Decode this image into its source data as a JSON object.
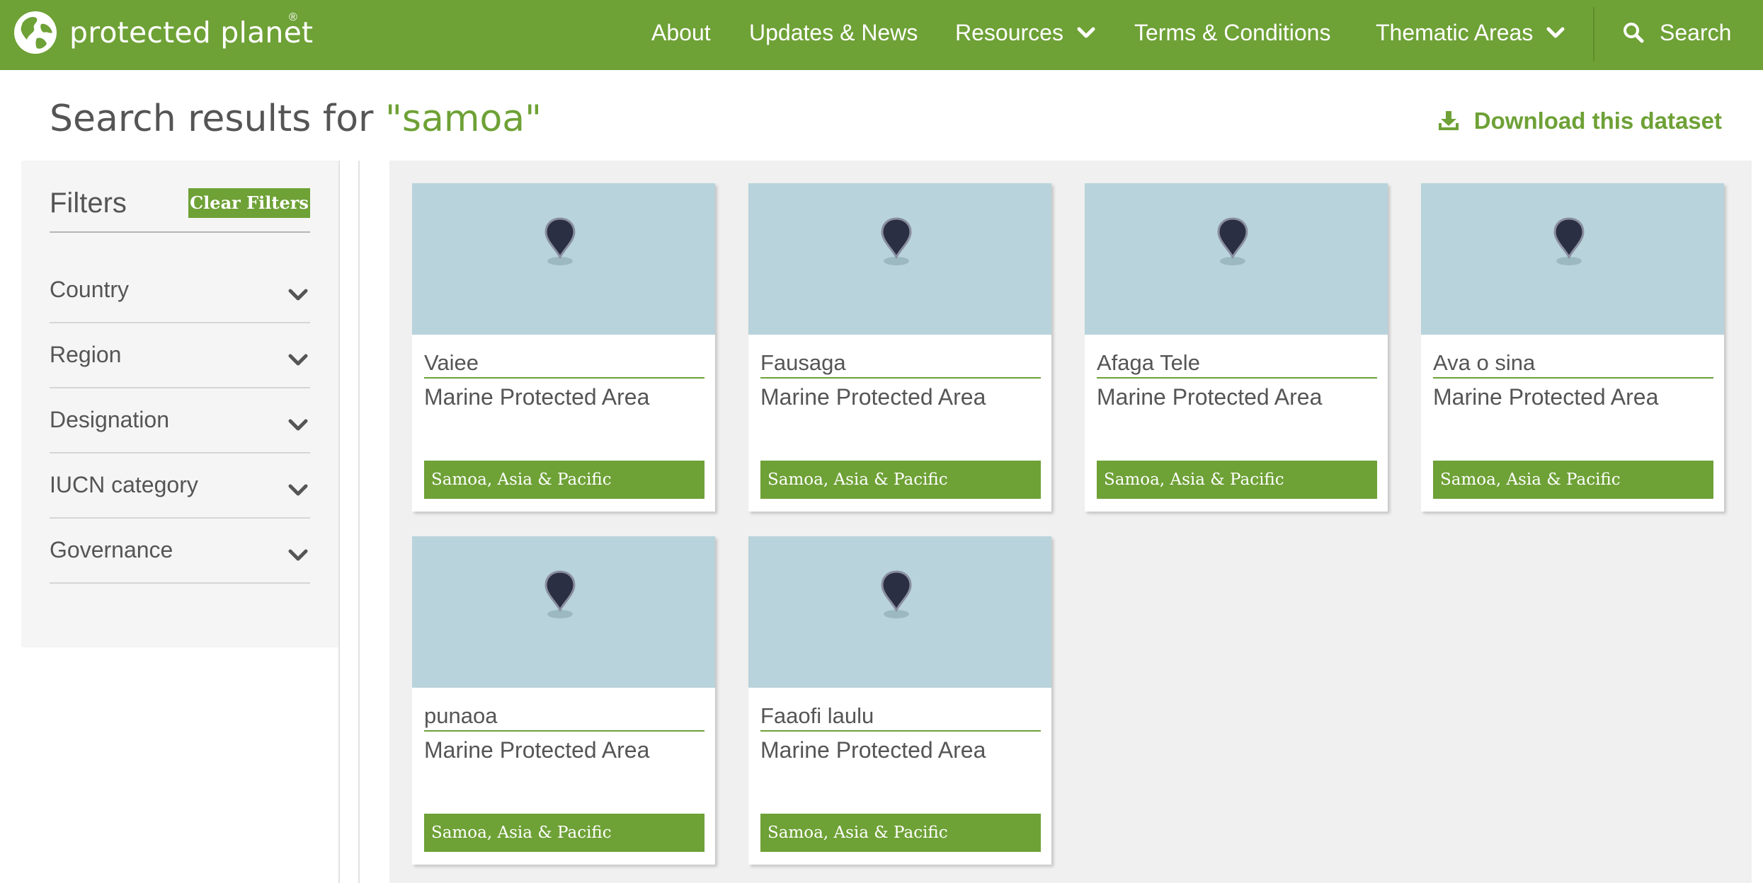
{
  "navbar": {
    "logo_text": "protected planet",
    "logo_reg": "®",
    "items": [
      {
        "label": "About"
      },
      {
        "label": "Updates & News"
      },
      {
        "label": "Resources"
      },
      {
        "label": "Terms & Conditions"
      },
      {
        "label": "Thematic Areas"
      }
    ],
    "search_label": "Search"
  },
  "header": {
    "title_prefix": "Search results for ",
    "query": "\"samoa\"",
    "download_label": "Download this dataset"
  },
  "filters": {
    "title": "Filters",
    "clear_label": "Clear Filters",
    "items": [
      {
        "label": "Country"
      },
      {
        "label": "Region"
      },
      {
        "label": "Designation"
      },
      {
        "label": "IUCN category"
      },
      {
        "label": "Governance"
      }
    ]
  },
  "results": [
    {
      "name": "Vaiee",
      "type": "Marine Protected Area",
      "location": "Samoa, Asia & Pacific"
    },
    {
      "name": "Fausaga",
      "type": "Marine Protected Area",
      "location": "Samoa, Asia & Pacific"
    },
    {
      "name": "Afaga Tele",
      "type": "Marine Protected Area",
      "location": "Samoa, Asia & Pacific"
    },
    {
      "name": "Ava o sina",
      "type": "Marine Protected Area",
      "location": "Samoa, Asia & Pacific"
    },
    {
      "name": "punaoa",
      "type": "Marine Protected Area",
      "location": "Samoa, Asia & Pacific"
    },
    {
      "name": "Faaofi laulu",
      "type": "Marine Protected Area",
      "location": "Samoa, Asia & Pacific"
    }
  ],
  "colors": {
    "brand_green": "#6ea136",
    "map_placeholder": "#b8d3db",
    "pin": "#2b2f44"
  },
  "icons": {
    "logo": "globe-icon",
    "dropdown": "chevron-down-icon",
    "search": "search-icon",
    "download": "download-icon",
    "map_marker": "map-pin-icon"
  }
}
